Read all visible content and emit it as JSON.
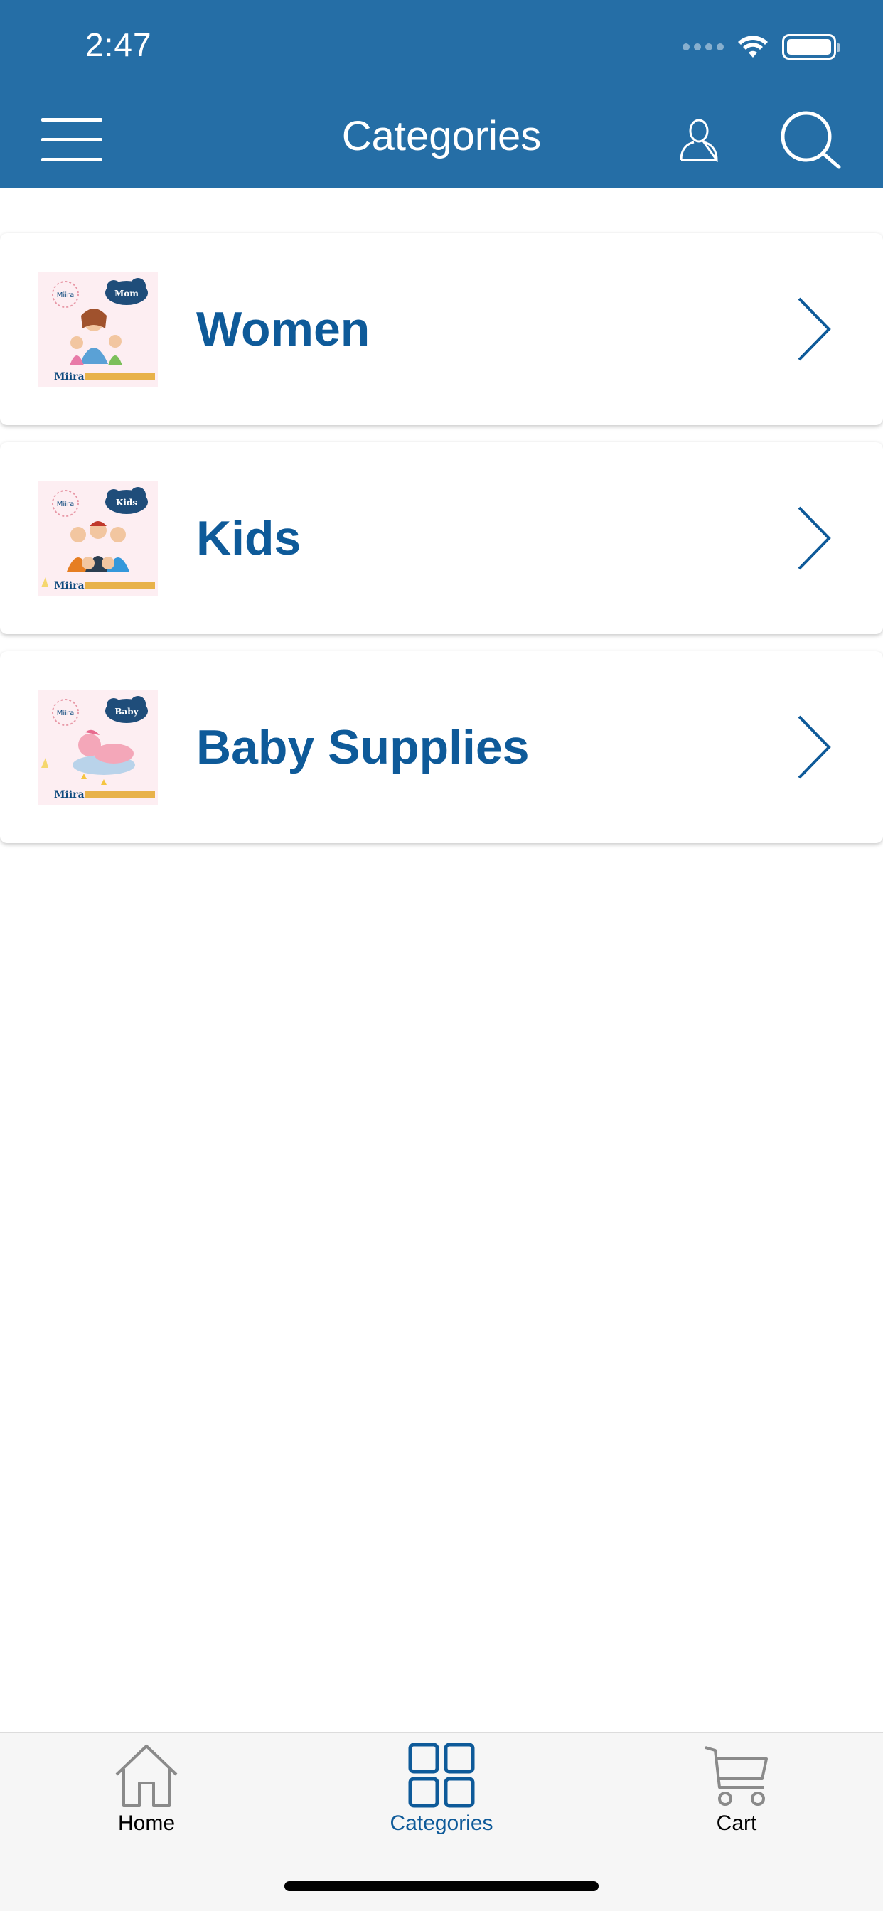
{
  "status_bar": {
    "time": "2:47"
  },
  "header": {
    "title": "Categories"
  },
  "categories": [
    {
      "label": "Women",
      "thumb_badge": "Mom",
      "thumb_brand": "Miira",
      "thumb_logo": "Miira"
    },
    {
      "label": "Kids",
      "thumb_badge": "Kids",
      "thumb_brand": "Miira",
      "thumb_logo": "Miira"
    },
    {
      "label": "Baby Supplies",
      "thumb_badge": "Baby",
      "thumb_brand": "Miira",
      "thumb_logo": "Miira"
    }
  ],
  "tabbar": {
    "tabs": [
      {
        "label": "Home",
        "icon": "home-icon",
        "active": false
      },
      {
        "label": "Categories",
        "icon": "grid-icon",
        "active": true
      },
      {
        "label": "Cart",
        "icon": "cart-icon",
        "active": false
      }
    ]
  },
  "colors": {
    "header_bg": "#256ea6",
    "accent": "#0e5a99",
    "tab_inactive": "#8a8a8a",
    "tab_bar_bg": "#f6f6f6"
  }
}
